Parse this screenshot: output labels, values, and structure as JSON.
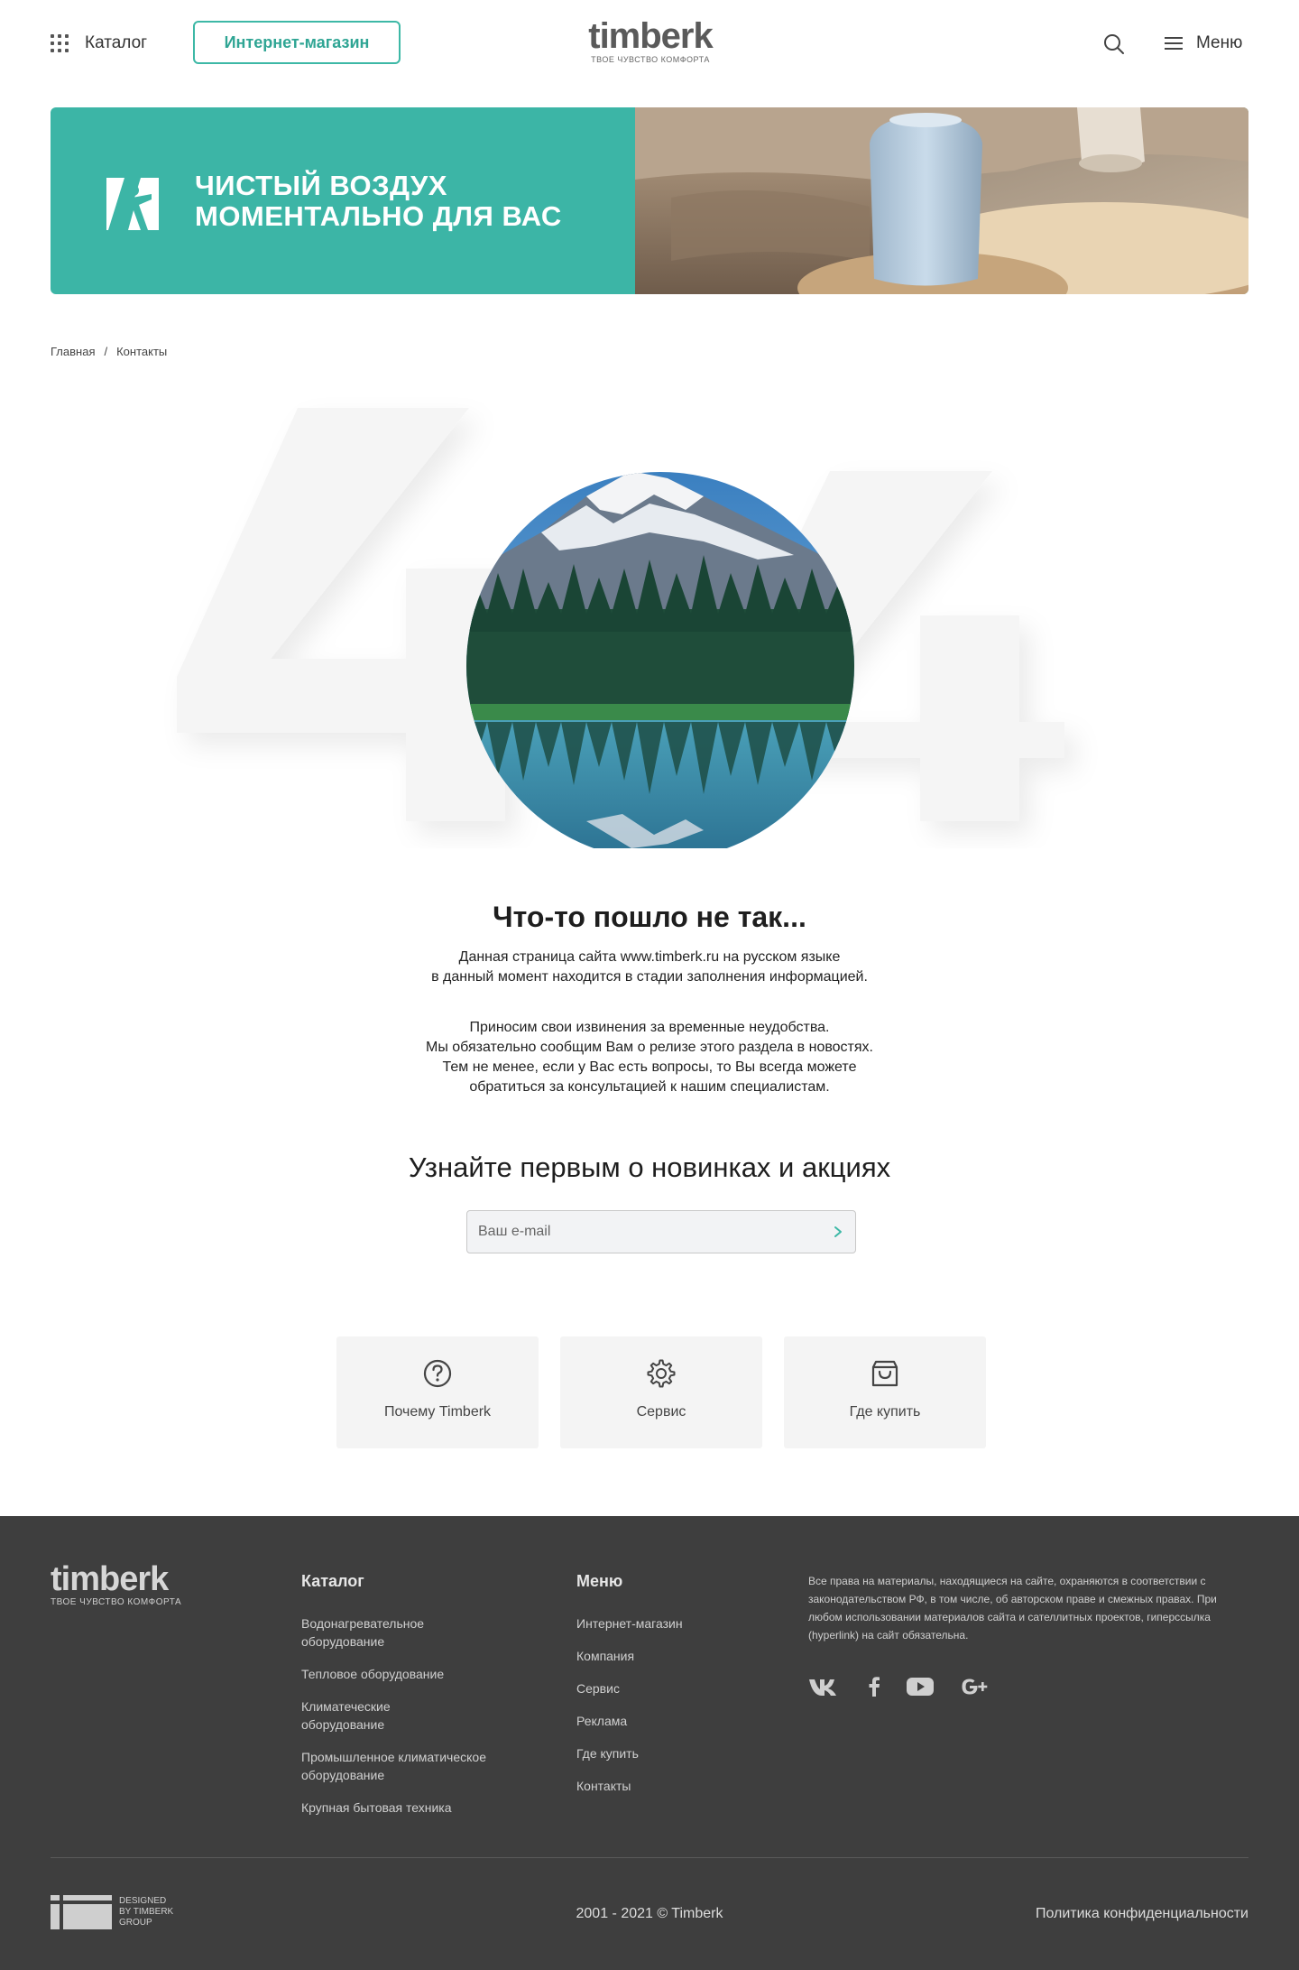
{
  "header": {
    "catalog_label": "Каталог",
    "shop_label": "Интернет-магазин",
    "logo_main": "timberk",
    "logo_tagline": "ТВОЕ ЧУВСТВО КОМФОРТА",
    "menu_label": "Меню"
  },
  "banner": {
    "line1": "ЧИСТЫЙ ВОЗДУХ",
    "line2": "МОМЕНТАЛЬНО ДЛЯ ВАС",
    "bg_color": "#3cb5a6"
  },
  "breadcrumb": {
    "home": "Главная",
    "separator": "/",
    "current": "Контакты"
  },
  "error": {
    "title": "Что-то пошло не так...",
    "p1_line1": "Данная страница сайта www.timberk.ru на русском языке",
    "p1_line2": "в данный момент находится в стадии заполнения информацией.",
    "p2_line1": "Приносим свои извинения за временные неудобства.",
    "p2_line2": "Мы обязательно сообщим Вам о релизе этого раздела в новостях.",
    "p2_line3": "Тем не менее, если у Вас есть вопросы, то Вы всегда можете",
    "p2_line4": "обратиться за консультацией к нашим специалистам."
  },
  "subscribe": {
    "title": "Узнайте первым о новинках и акциях",
    "placeholder": "Ваш e-mail"
  },
  "cards": [
    {
      "label": "Почему Timberk",
      "icon": "question-icon"
    },
    {
      "label": "Сервис",
      "icon": "gear-icon"
    },
    {
      "label": "Где купить",
      "icon": "shopping-bag-icon"
    }
  ],
  "footer": {
    "logo_main": "timberk",
    "logo_tagline": "ТВОЕ ЧУВСТВО КОМФОРТА",
    "catalog_title": "Каталог",
    "catalog_items": [
      "Водонагревательное оборудование",
      "Тепловое оборудование",
      "Климатеческие оборудование",
      "Промышленное климатическое оборудование",
      "Крупная бытовая техника"
    ],
    "menu_title": "Меню",
    "menu_items": [
      "Интернет-магазин",
      "Компания",
      "Сервис",
      "Реклама",
      "Где купить",
      "Контакты"
    ],
    "rights_text": "Все права на материалы, находящиеся на сайте, охраняются в соответствии с законодательством РФ, в том числе, об авторском праве и смежных правах. При любом использовании материалов сайта и сателлитных проектов, гиперссылка (hyperlink) на сайт обязательна.",
    "socials": [
      "vk-icon",
      "facebook-icon",
      "youtube-icon",
      "google-plus-icon"
    ],
    "designed_line1": "DESIGNED",
    "designed_line2": "BY TIMBERK",
    "designed_line3": "GROUP",
    "copyright": "2001 - 2021 © Timberk",
    "policy": "Политика конфиденциальности"
  },
  "colors": {
    "accent": "#3db8a6",
    "footer_bg": "#3e3e3e"
  }
}
